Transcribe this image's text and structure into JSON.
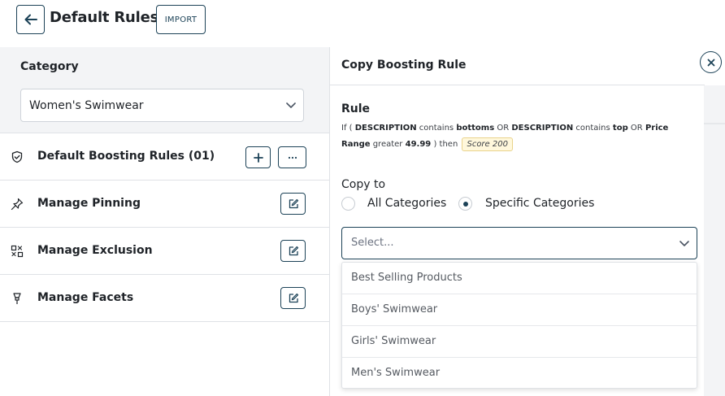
{
  "header": {
    "title": "Default Rules",
    "import_label": "IMPORT"
  },
  "category": {
    "label": "Category",
    "selected": "Women's Swimwear"
  },
  "menu": [
    {
      "label": "Default Boosting Rules (01)",
      "icon": "shield-check-icon"
    },
    {
      "label": "Manage Pinning",
      "icon": "pin-icon"
    },
    {
      "label": "Manage Exclusion",
      "icon": "exclusion-icon"
    },
    {
      "label": "Manage Facets",
      "icon": "facet-icon"
    }
  ],
  "modal": {
    "title": "Copy Boosting Rule",
    "rule_label": "Rule",
    "rule": {
      "if": "If (",
      "field1": "DESCRIPTION",
      "op1": "contains",
      "val1": "bottoms",
      "or1": "OR",
      "field2": "DESCRIPTION",
      "op2": "contains",
      "val2": "top",
      "or2": "OR",
      "field3": "Price",
      "field3b": "Range",
      "op3": "greater",
      "val3": "49.99",
      "close": ")",
      "then": "then",
      "score": "Score 200"
    },
    "copy_to_label": "Copy to",
    "options": [
      {
        "label": "All Categories",
        "checked": false
      },
      {
        "label": "Specific Categories",
        "checked": true
      }
    ],
    "select_placeholder": "Select...",
    "dropdown_items": [
      "Best Selling Products",
      "Boys' Swimwear",
      "Girls' Swimwear",
      "Men's Swimwear"
    ]
  },
  "colors": {
    "accent": "#1c4257",
    "panel_bg": "#f3f4f6",
    "score_chip_bg": "#fff8dc"
  }
}
